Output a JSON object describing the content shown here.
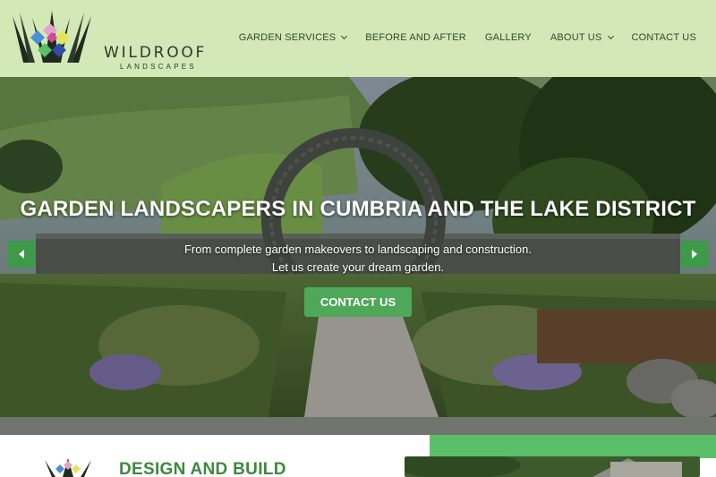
{
  "header": {
    "logo_word": "WILDROOF",
    "logo_sub": "LANDSCAPES",
    "nav": [
      {
        "label": "GARDEN SERVICES",
        "has_dropdown": true
      },
      {
        "label": "BEFORE AND AFTER",
        "has_dropdown": false
      },
      {
        "label": "GALLERY",
        "has_dropdown": false
      },
      {
        "label": "ABOUT US",
        "has_dropdown": true
      },
      {
        "label": "CONTACT US",
        "has_dropdown": false
      }
    ]
  },
  "hero": {
    "title": "GARDEN LANDSCAPERS IN CUMBRIA AND THE LAKE DISTRICT",
    "subtitle_line1": "From complete garden makeovers to landscaping and construction.",
    "subtitle_line2": "Let us create your dream garden.",
    "button_label": "CONTACT US",
    "prev_icon": "chevron-left-icon",
    "next_icon": "chevron-right-icon"
  },
  "section": {
    "title": "DESIGN AND BUILD"
  },
  "colors": {
    "header_bg": "#d2e8b6",
    "accent_green": "#4fa85a",
    "title_green": "#3c8a3f"
  }
}
